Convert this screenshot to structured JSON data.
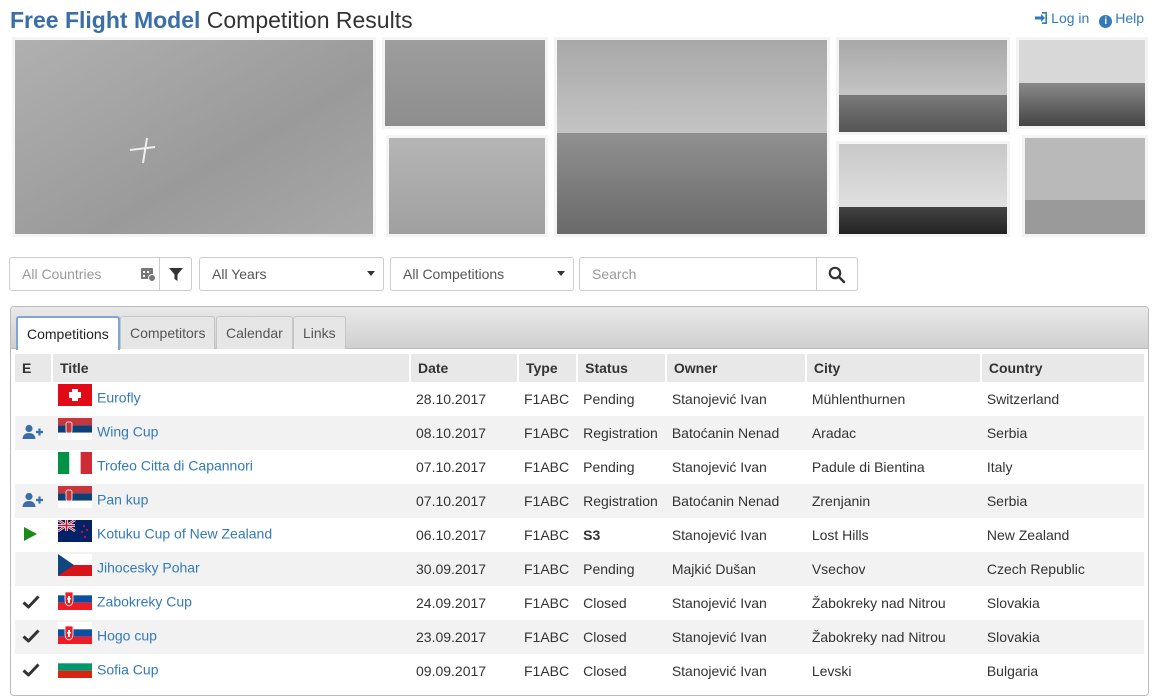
{
  "header": {
    "brand_bold": "Free Flight Model",
    "brand_rest": "Competition Results",
    "login_label": "Log in",
    "help_label": "Help"
  },
  "filters": {
    "country_placeholder": "All Countries",
    "year_selected": "All Years",
    "competition_selected": "All Competitions",
    "search_placeholder": "Search"
  },
  "tabs": [
    {
      "label": "Competitions",
      "active": true
    },
    {
      "label": "Competitors",
      "active": false
    },
    {
      "label": "Calendar",
      "active": false
    },
    {
      "label": "Links",
      "active": false
    }
  ],
  "table": {
    "columns": [
      "E",
      "Title",
      "Date",
      "Type",
      "Status",
      "Owner",
      "City",
      "Country"
    ],
    "rows": [
      {
        "e_icon": "",
        "flag": "switzerland-flag-icon",
        "title": "Eurofly",
        "date": "28.10.2017",
        "type": "F1ABC",
        "status": "Pending",
        "status_kind": "pending",
        "owner": "Stanojević Ivan",
        "city": "Mühlenthurnen",
        "country": "Switzerland"
      },
      {
        "e_icon": "add-user-icon",
        "flag": "serbia-flag-icon",
        "title": "Wing Cup",
        "date": "08.10.2017",
        "type": "F1ABC",
        "status": "Registration",
        "status_kind": "registration",
        "owner": "Batoćanin Nenad",
        "city": "Aradac",
        "country": "Serbia"
      },
      {
        "e_icon": "",
        "flag": "italy-flag-icon",
        "title": "Trofeo Citta di Capannori",
        "date": "07.10.2017",
        "type": "F1ABC",
        "status": "Pending",
        "status_kind": "pending",
        "owner": "Stanojević Ivan",
        "city": "Padule di Bientina",
        "country": "Italy"
      },
      {
        "e_icon": "add-user-icon",
        "flag": "serbia-flag-icon",
        "title": "Pan kup",
        "date": "07.10.2017",
        "type": "F1ABC",
        "status": "Registration",
        "status_kind": "registration",
        "owner": "Batoćanin Nenad",
        "city": "Zrenjanin",
        "country": "Serbia"
      },
      {
        "e_icon": "play-icon",
        "flag": "new-zealand-flag-icon",
        "title": "Kotuku Cup of New Zealand",
        "date": "06.10.2017",
        "type": "F1ABC",
        "status": "S3",
        "status_kind": "live",
        "owner": "Stanojević Ivan",
        "city": "Lost Hills",
        "country": "New Zealand"
      },
      {
        "e_icon": "",
        "flag": "czech-flag-icon",
        "title": "Jihocesky Pohar",
        "date": "30.09.2017",
        "type": "F1ABC",
        "status": "Pending",
        "status_kind": "pending",
        "owner": "Majkić Dušan",
        "city": "Vsechov",
        "country": "Czech Republic"
      },
      {
        "e_icon": "check-icon",
        "flag": "slovakia-flag-icon",
        "title": "Zabokreky Cup",
        "date": "24.09.2017",
        "type": "F1ABC",
        "status": "Closed",
        "status_kind": "closed",
        "owner": "Stanojević Ivan",
        "city": "Žabokreky nad Nitrou",
        "country": "Slovakia"
      },
      {
        "e_icon": "check-icon",
        "flag": "slovakia-flag-icon",
        "title": "Hogo cup",
        "date": "23.09.2017",
        "type": "F1ABC",
        "status": "Closed",
        "status_kind": "closed",
        "owner": "Stanojević Ivan",
        "city": "Žabokreky nad Nitrou",
        "country": "Slovakia"
      },
      {
        "e_icon": "check-icon",
        "flag": "bulgaria-flag-icon",
        "title": "Sofia Cup",
        "date": "09.09.2017",
        "type": "F1ABC",
        "status": "Closed",
        "status_kind": "closed",
        "owner": "Stanojević Ivan",
        "city": "Levski",
        "country": "Bulgaria"
      }
    ]
  },
  "colors": {
    "brand_blue": "#3a6ea8",
    "link_blue": "#337ab7",
    "registration_purple": "#3b2fb0",
    "live_green": "#1a8a1a",
    "pending_gray": "#888888"
  }
}
